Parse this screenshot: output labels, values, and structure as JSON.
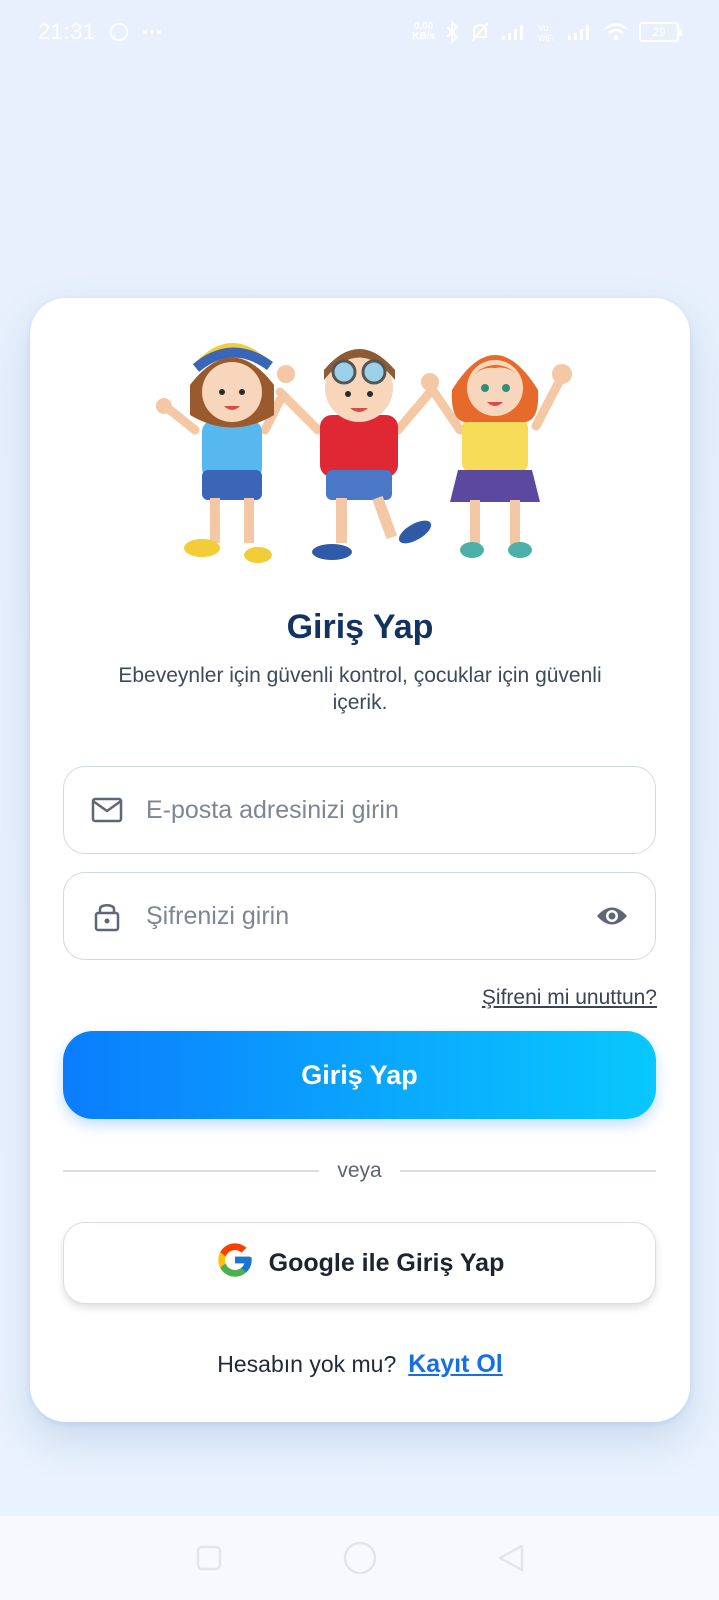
{
  "status_bar": {
    "time": "21:31",
    "net_speed_top": "0,00",
    "net_speed_bottom": "KB/s",
    "battery": "29"
  },
  "login": {
    "title": "Giriş Yap",
    "subtitle": "Ebeveynler için güvenli kontrol, çocuklar için güvenli içerik.",
    "email_placeholder": "E-posta adresinizi girin",
    "password_placeholder": "Şifrenizi girin",
    "forgot_password": "Şifreni mi unuttun?",
    "login_button": "Giriş Yap",
    "divider_text": "veya",
    "google_button": "Google ile Giriş Yap",
    "no_account": "Hesabın yok mu?",
    "signup_link": "Kayıt Ol"
  },
  "colors": {
    "title": "#12335f",
    "primary_gradient_start": "#0a7dfd",
    "primary_gradient_end": "#08c8fd",
    "link": "#1570e6",
    "background": "#e7f0fc"
  },
  "icons": {
    "email_field": "mail-icon",
    "password_field": "lock-icon",
    "password_toggle": "eye-icon",
    "google": "google-logo-icon"
  }
}
